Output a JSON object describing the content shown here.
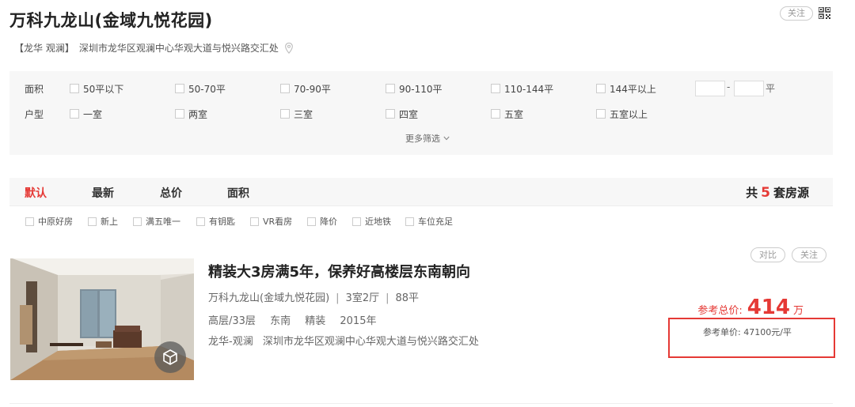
{
  "header": {
    "title": "万科九龙山(金域九悦花园)",
    "follow_label": "关注",
    "district": "【龙华 观澜】",
    "address": "深圳市龙华区观澜中心华观大道与悦兴路交汇处"
  },
  "filters": {
    "area": {
      "label": "面积",
      "options": [
        "50平以下",
        "50-70平",
        "70-90平",
        "90-110平",
        "110-144平",
        "144平以上"
      ],
      "range_separator": "-",
      "range_unit": "平"
    },
    "layout": {
      "label": "户型",
      "options": [
        "一室",
        "两室",
        "三室",
        "四室",
        "五室",
        "五室以上"
      ]
    },
    "more_label": "更多筛选"
  },
  "sort": {
    "items": [
      "默认",
      "最新",
      "总价",
      "面积"
    ],
    "active": "默认",
    "total_prefix": "共",
    "total_count": "5",
    "total_suffix": "套房源"
  },
  "tags": [
    "中原好房",
    "新上",
    "满五唯一",
    "有钥匙",
    "VR看房",
    "降价",
    "近地铁",
    "车位充足"
  ],
  "listing": {
    "title": "精装大3房满5年，保养好高楼层东南朝向",
    "community": "万科九龙山(金域九悦花园)",
    "rooms": "3室2厅",
    "size": "88平",
    "floor": "高层/33层",
    "orientation": "东南",
    "decoration": "精装",
    "year": "2015年",
    "area_tag": "龙华-观澜",
    "address": "深圳市龙华区观澜中心华观大道与悦兴路交汇处",
    "compare_label": "对比",
    "follow_label": "关注",
    "total_price_label": "参考总价:",
    "total_price": "414",
    "total_price_unit": "万",
    "unit_price_label": "参考单价:",
    "unit_price": "47100元/平"
  },
  "colors": {
    "accent": "#e53935",
    "filter_bg": "#f7f7f7"
  }
}
